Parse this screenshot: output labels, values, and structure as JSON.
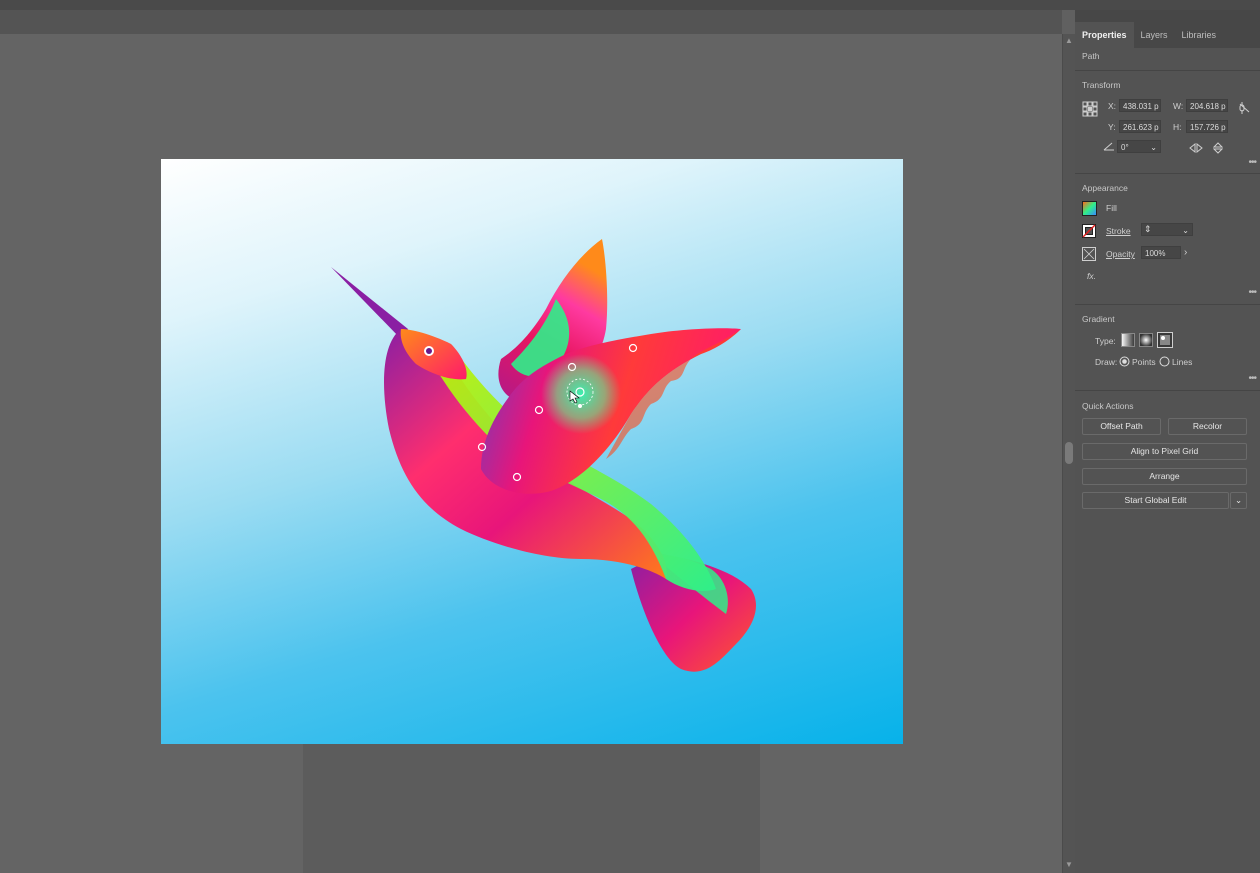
{
  "panel": {
    "tabs": [
      {
        "label": "Properties"
      },
      {
        "label": "Layers"
      },
      {
        "label": "Libraries"
      }
    ],
    "object_type": "Path",
    "transform": {
      "title": "Transform",
      "x_label": "X:",
      "x_value": "438.031 p",
      "y_label": "Y:",
      "y_value": "261.623 p",
      "w_label": "W:",
      "w_value": "204.618 p",
      "h_label": "H:",
      "h_value": "157.726 p",
      "angle_value": "0°"
    },
    "appearance": {
      "title": "Appearance",
      "fill_label": "Fill",
      "stroke_label": "Stroke",
      "opacity_label": "Opacity",
      "opacity_value": "100%",
      "fx_label": "fx."
    },
    "gradient": {
      "title": "Gradient",
      "type_label": "Type:",
      "draw_label": "Draw:",
      "points_label": "Points",
      "lines_label": "Lines",
      "selected_draw": "Points"
    },
    "quick_actions": {
      "title": "Quick Actions",
      "offset_path": "Offset Path",
      "recolor": "Recolor",
      "align_pixel_grid": "Align to Pixel Grid",
      "arrange": "Arrange",
      "start_global_edit": "Start Global Edit"
    }
  },
  "colors": {
    "workspace": "#646464",
    "panel": "#535353",
    "sky_top": "#ffffff",
    "sky_bottom": "#07b2ea",
    "bird_magenta": "#e8157a",
    "bird_orange": "#ff7a1a",
    "bird_lime": "#c8f000",
    "bird_purple": "#8a1fa3"
  },
  "icons": [
    "reference-point-icon",
    "constrain-proportions-icon",
    "angle-icon",
    "flip-horizontal-icon",
    "flip-vertical-icon",
    "fill-swatch-icon",
    "stroke-swatch-icon",
    "opacity-icon",
    "more-options-icon",
    "chevron-down-icon"
  ]
}
